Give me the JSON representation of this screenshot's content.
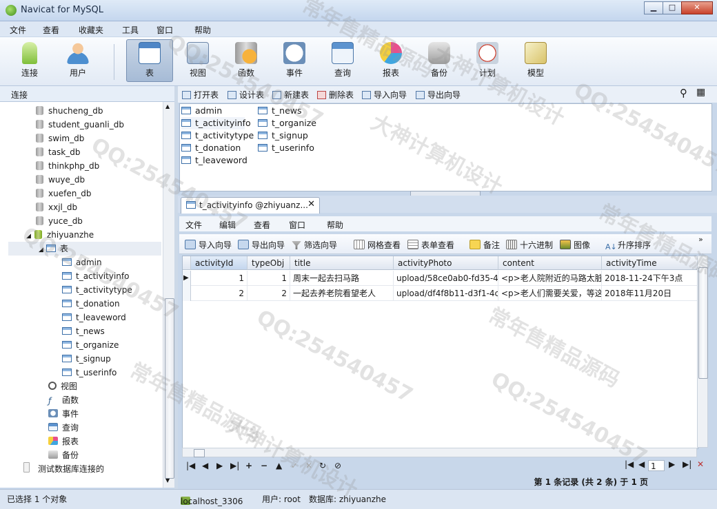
{
  "window": {
    "title": "Navicat for MySQL",
    "minimize": "▁",
    "maximize": "□",
    "close": "✕"
  },
  "menu": [
    "文件",
    "查看",
    "收藏夹",
    "工具",
    "窗口",
    "帮助"
  ],
  "toolbar": [
    {
      "label": "连接",
      "icon": "connection-icon"
    },
    {
      "label": "用户",
      "icon": "user-icon"
    },
    {
      "label": "表",
      "icon": "table-icon",
      "active": true
    },
    {
      "label": "视图",
      "icon": "view-icon"
    },
    {
      "label": "函数",
      "icon": "function-icon"
    },
    {
      "label": "事件",
      "icon": "event-icon"
    },
    {
      "label": "查询",
      "icon": "query-icon"
    },
    {
      "label": "报表",
      "icon": "report-icon"
    },
    {
      "label": "备份",
      "icon": "backup-icon"
    },
    {
      "label": "计划",
      "icon": "schedule-icon"
    },
    {
      "label": "模型",
      "icon": "model-icon"
    }
  ],
  "left_header": "连接",
  "tree": {
    "databases": [
      "shucheng_db",
      "student_guanli_db",
      "swim_db",
      "task_db",
      "thinkphp_db",
      "wuye_db",
      "xuefen_db",
      "xxjl_db",
      "yuce_db"
    ],
    "open_db": "zhiyuanzhe",
    "tables_node": "表",
    "tables": [
      "admin",
      "t_activityinfo",
      "t_activitytype",
      "t_donation",
      "t_leaveword",
      "t_news",
      "t_organize",
      "t_signup",
      "t_userinfo"
    ],
    "other_nodes": [
      "视图",
      "函数",
      "事件",
      "查询",
      "报表",
      "备份"
    ],
    "connection2": "测试数据库连接的"
  },
  "object_toolbar": [
    "打开表",
    "设计表",
    "新建表",
    "删除表",
    "导入向导",
    "导出向导"
  ],
  "object_list": {
    "col1": [
      "admin",
      "t_activityinfo",
      "t_activitytype",
      "t_donation",
      "t_leaveword"
    ],
    "col2": [
      "t_news",
      "t_organize",
      "t_signup",
      "t_userinfo"
    ]
  },
  "tab": {
    "title": "t_activityinfo @zhiyuanz...",
    "close": "✕"
  },
  "inner_menu": [
    "文件",
    "编辑",
    "查看",
    "窗口",
    "帮助"
  ],
  "inner_toolbar": [
    "导入向导",
    "导出向导",
    "筛选向导",
    "网格查看",
    "表单查看",
    "备注",
    "十六进制",
    "图像",
    "升序排序"
  ],
  "grid": {
    "columns": [
      "activityId",
      "typeObj",
      "title",
      "activityPhoto",
      "content",
      "activityTime"
    ],
    "rows": [
      [
        "1",
        "1",
        "周末一起去扫马路",
        "upload/58ce0ab0-fd35-4",
        "<p>老人院附近的马路太脏",
        "2018-11-24下午3点"
      ],
      [
        "2",
        "2",
        "一起去养老院看望老人",
        "upload/df4f8b11-d3f1-4c",
        "<p>老人们需要关爱，等这",
        "2018年11月20日"
      ]
    ]
  },
  "pager": {
    "page": "1"
  },
  "record_status": "第 1 条记录 (共 2 条) 于 1 页",
  "status": {
    "selected": "已选择 1 个对象",
    "connection": "localhost_3306",
    "user": "用户: root",
    "database": "数据库: zhiyuanzhe"
  },
  "watermarks": [
    "常年售精品源码",
    "QQ:254540457",
    "大神计算机设计"
  ],
  "colors": {
    "accent": "#3c6fa8",
    "selected_header": "#c4d6ee",
    "status_bar": "#dbe5f2"
  }
}
